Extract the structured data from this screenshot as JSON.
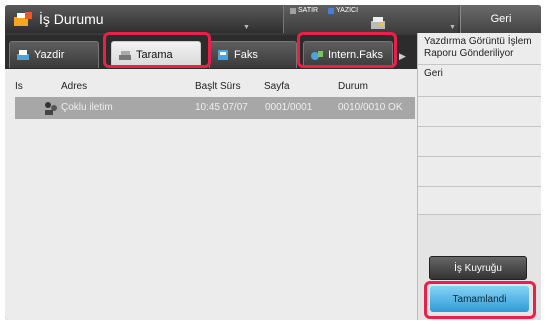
{
  "header": {
    "title": "İş Durumu",
    "status_indicator_1": "SATIR",
    "status_indicator_2": "YAZICI",
    "back_label": "Geri"
  },
  "tabs": [
    {
      "label": "Yazdir",
      "icon": "printer-icon"
    },
    {
      "label": "Tarama",
      "icon": "scanner-icon"
    },
    {
      "label": "Faks",
      "icon": "fax-icon"
    },
    {
      "label": "Intern.Faks",
      "icon": "internet-fax-icon"
    }
  ],
  "table": {
    "columns": [
      "Is",
      "Adres",
      "Başlt Sürs",
      "Sayfa",
      "Durum"
    ],
    "rows": [
      {
        "address": "Çoklu iletim",
        "start_time": "10:45 07/07",
        "pages": "0001/0001",
        "status": "0010/0010 OK"
      }
    ]
  },
  "side_menu": {
    "items": [
      "Yazdırma Görüntü İşlem Raporu Gönderiliyor",
      "Geri"
    ],
    "queue_button": "İş Kuyruğu",
    "completed_button": "Tamamlandi"
  },
  "colors": {
    "highlight": "#e8204a",
    "accent_button": "#3fa9e0",
    "led_line": "#a0a0a0",
    "led_printer": "#4b7bd6"
  }
}
